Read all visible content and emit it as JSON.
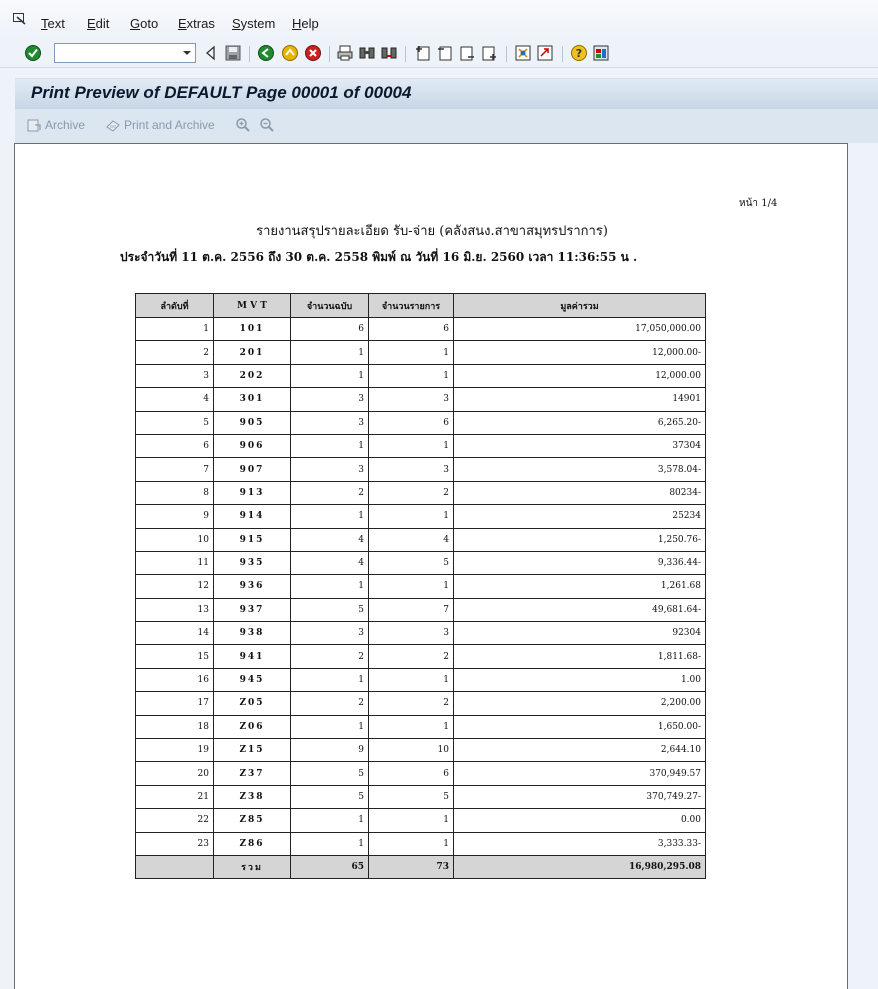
{
  "menu": [
    "Text",
    "Edit",
    "Goto",
    "Extras",
    "System",
    "Help"
  ],
  "command_field": {
    "value": ""
  },
  "title": "Print Preview of DEFAULT Page 00001 of 00004",
  "app_toolbar": {
    "archive": "Archive",
    "print_archive": "Print and Archive"
  },
  "report": {
    "page": "หน้า  1/4",
    "title": "รายงานสรุปรายละเอียด     รับ-จ่าย    (คลังสนง.สาขาสมุทรปราการ)",
    "subtitle": "ประจำวันที่  11  ต.ค.  2556       ถึง 30     ต.ค.     2558  พิมพ์  ณ  วันที่ 16      มิ.ย.     2560  เวลา   11:36:55 น .",
    "headers": [
      "ลำดับที่",
      "M V T",
      "จำนวนฉบับ",
      "จำนวนรายการ",
      "มูลค่ารวม"
    ],
    "rows": [
      [
        "1",
        "101",
        "6",
        "6",
        "17,050,000.00"
      ],
      [
        "2",
        "201",
        "1",
        "1",
        "12,000.00-"
      ],
      [
        "3",
        "202",
        "1",
        "1",
        "12,000.00"
      ],
      [
        "4",
        "301",
        "3",
        "3",
        "14901"
      ],
      [
        "5",
        "905",
        "3",
        "6",
        "6,265.20-"
      ],
      [
        "6",
        "906",
        "1",
        "1",
        "37304"
      ],
      [
        "7",
        "907",
        "3",
        "3",
        "3,578.04-"
      ],
      [
        "8",
        "913",
        "2",
        "2",
        "80234-"
      ],
      [
        "9",
        "914",
        "1",
        "1",
        "25234"
      ],
      [
        "10",
        "915",
        "4",
        "4",
        "1,250.76-"
      ],
      [
        "11",
        "935",
        "4",
        "5",
        "9,336.44-"
      ],
      [
        "12",
        "936",
        "1",
        "1",
        "1,261.68"
      ],
      [
        "13",
        "937",
        "5",
        "7",
        "49,681.64-"
      ],
      [
        "14",
        "938",
        "3",
        "3",
        "92304"
      ],
      [
        "15",
        "941",
        "2",
        "2",
        "1,811.68-"
      ],
      [
        "16",
        "945",
        "1",
        "1",
        "1.00"
      ],
      [
        "17",
        "Z05",
        "2",
        "2",
        "2,200.00"
      ],
      [
        "18",
        "Z06",
        "1",
        "1",
        "1,650.00-"
      ],
      [
        "19",
        "Z15",
        "9",
        "10",
        "2,644.10"
      ],
      [
        "20",
        "Z37",
        "5",
        "6",
        "370,949.57"
      ],
      [
        "21",
        "Z38",
        "5",
        "5",
        "370,749.27-"
      ],
      [
        "22",
        "Z85",
        "1",
        "1",
        "0.00"
      ],
      [
        "23",
        "Z86",
        "1",
        "1",
        "3,333.33-"
      ]
    ],
    "total": [
      "",
      "รวม",
      "65",
      "73",
      "16,980,295.08"
    ]
  }
}
